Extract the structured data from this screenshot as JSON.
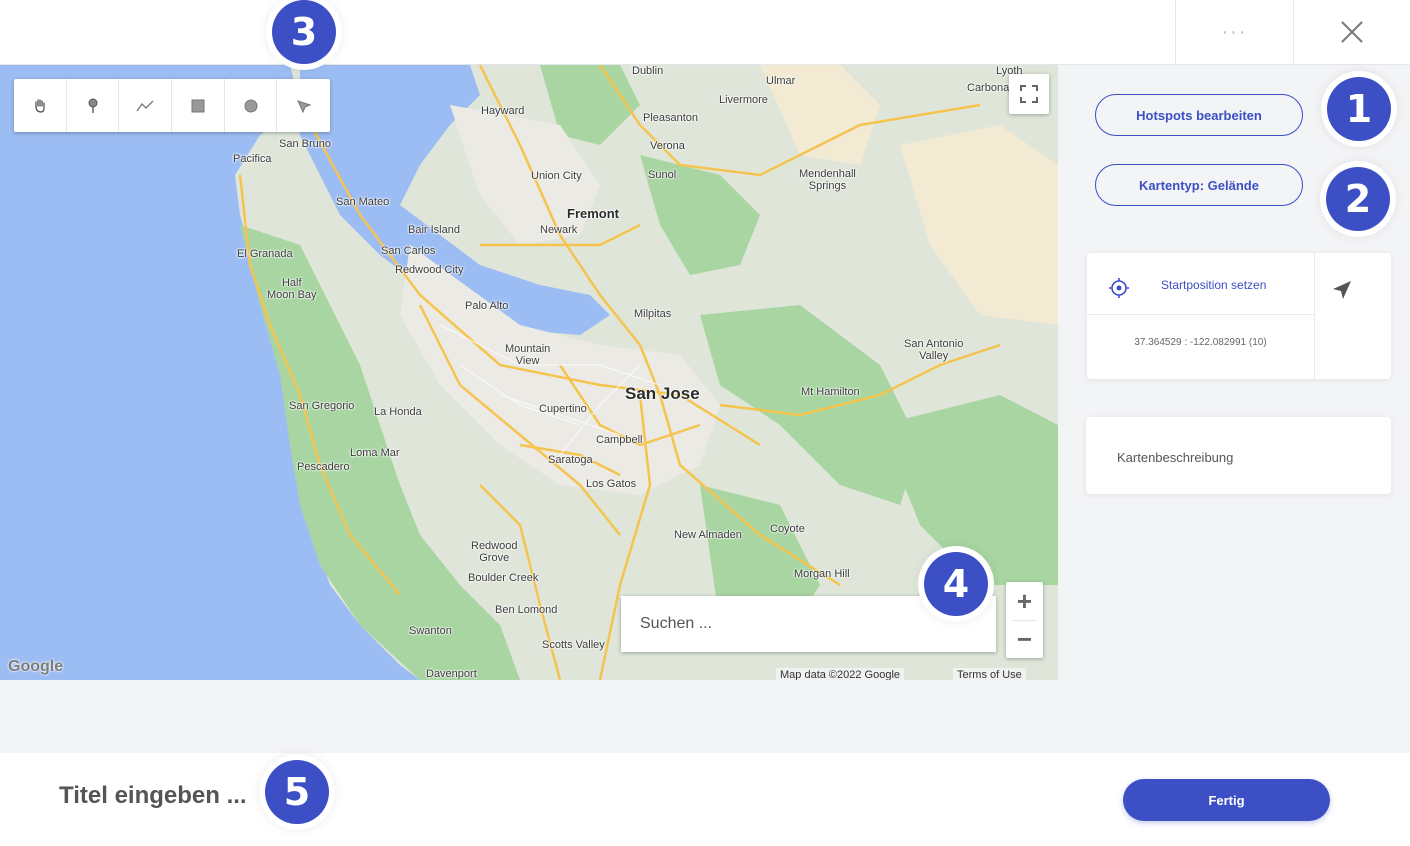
{
  "header": {
    "more_label": "···",
    "close_icon": "close-icon"
  },
  "badges": {
    "b1": "1",
    "b2": "2",
    "b3": "3",
    "b4": "4",
    "b5": "5"
  },
  "map": {
    "toolbar": [
      {
        "icon": "hand-icon"
      },
      {
        "icon": "marker-icon"
      },
      {
        "icon": "polyline-icon"
      },
      {
        "icon": "rectangle-icon"
      },
      {
        "icon": "circle-icon"
      },
      {
        "icon": "polygon-icon"
      }
    ],
    "search_placeholder": "Suchen ...",
    "zoom_in": "+",
    "zoom_out": "−",
    "google_logo": "Google",
    "map_data": "Map data ©2022 Google",
    "terms": "Terms of Use",
    "places": {
      "san_jose": "San Jose",
      "fremont": "Fremont",
      "dublin": "Dublin",
      "livermore": "Livermore",
      "pleasanton": "Pleasanton",
      "hayward": "Hayward",
      "san_bruno": "San Bruno",
      "pacifica": "Pacifica",
      "san_mateo": "San Mateo",
      "bair_island": "Bair Island",
      "san_carlos": "San Carlos",
      "redwood_city": "Redwood City",
      "el_granada": "El Granada",
      "half_moon_bay": "Half\nMoon Bay",
      "palo_alto": "Palo Alto",
      "mountain_view": "Mountain\nView",
      "milpitas": "Milpitas",
      "union_city": "Union City",
      "newark": "Newark",
      "sunol": "Sunol",
      "verona": "Verona",
      "ulmar": "Ulmar",
      "lyoth": "Lyoth",
      "carbona": "Carbona",
      "mendenhall_springs": "Mendenhall\nSprings",
      "san_antonio_valley": "San Antonio\nValley",
      "mt_hamilton": "Mt Hamilton",
      "san_gregorio": "San Gregorio",
      "la_honda": "La Honda",
      "cupertino": "Cupertino",
      "campbell": "Campbell",
      "loma_mar": "Loma Mar",
      "saratoga": "Saratoga",
      "pescadero": "Pescadero",
      "los_gatos": "Los Gatos",
      "coyote": "Coyote",
      "new_almaden": "New Almaden",
      "redwood_grove": "Redwood\nGrove",
      "boulder_creek": "Boulder Creek",
      "morgan_hill": "Morgan Hill",
      "ben_lomond": "Ben Lomond",
      "swanton": "Swanton",
      "scotts_valley": "Scotts Valley",
      "davenport": "Davenport"
    }
  },
  "sidebar": {
    "hotspots_button": "Hotspots bearbeiten",
    "maptype_button": "Kartentyp: Gelände",
    "start_position_label": "Startposition setzen",
    "coords": "37.364529 : -122.082991 (10)",
    "description_label": "Kartenbeschreibung"
  },
  "footer": {
    "title_placeholder": "Titel eingeben ...",
    "done_button": "Fertig"
  },
  "colors": {
    "accent": "#3c4fc4",
    "water": "#9cbdf4",
    "land": "#dfe6d9",
    "park": "#a8d5a2",
    "road": "#f5c44e"
  }
}
